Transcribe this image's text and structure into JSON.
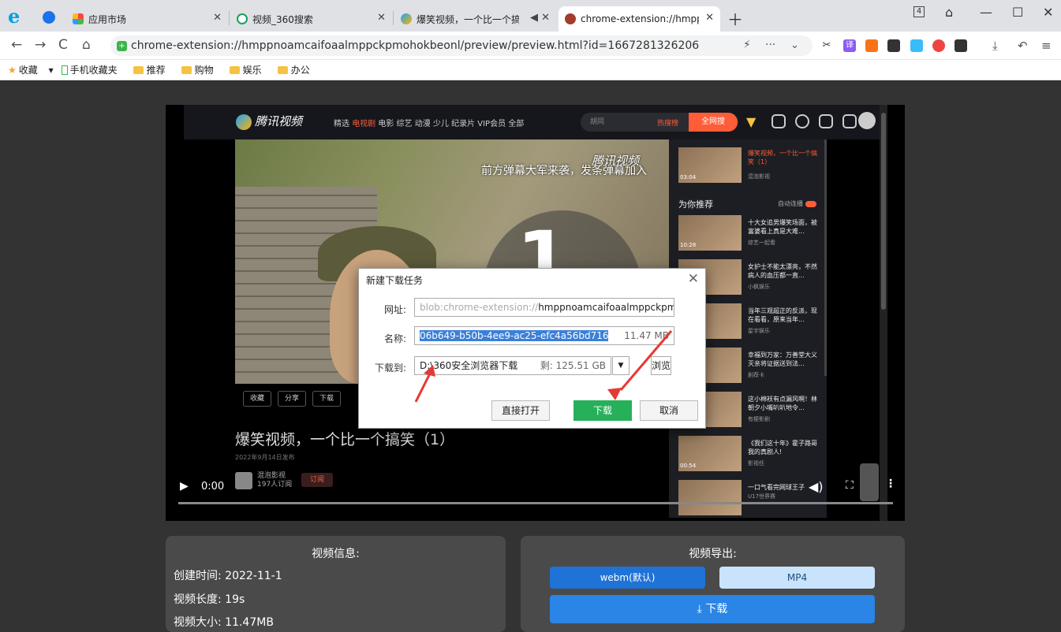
{
  "browser": {
    "tabs": [
      {
        "label": "应用市场"
      },
      {
        "label": "视频_360搜索"
      },
      {
        "label": "爆笑视频，一个比一个搞笑"
      },
      {
        "label": "chrome-extension://hmppnc"
      }
    ],
    "address": "chrome-extension://hmppnoamcaifoaalmppckpmohokbeonl/preview/preview.html?id=1667281326206",
    "bookmarks": [
      "收藏",
      "手机收藏夹",
      "推荐",
      "购物",
      "娱乐",
      "办公"
    ]
  },
  "video": {
    "site_name": "腾讯视频",
    "nav": "精选 电视剧 电影 综艺 动漫 少儿 纪录片 VIP会员 全部",
    "nav_active": "电视剧",
    "search_placeholder": "胡同",
    "hot_label": "热搜榜",
    "search_btn": "全网搜",
    "danmu": "前方弹幕大军来袭，发条弹幕加入",
    "watermark": "腾讯视频",
    "overlay_number": "1",
    "actions": [
      "收藏",
      "分享",
      "下载"
    ],
    "title": "爆笑视频，一个比一个搞笑（1）",
    "date": "2022年9月14日发布",
    "channel": "混泡影视",
    "subscribers": "197人订阅",
    "subscribe_label": "订阅",
    "time": "0:00",
    "recommend_label": "为你推荐",
    "autoplay_label": "自动连播",
    "side_items": [
      {
        "title": "爆笑视频，一个比一个搞笑（1）",
        "channel": "混泡影视",
        "duration": "03:04"
      },
      {
        "title": "十大女追男爆笑场面，被富婆看上真是大难...",
        "channel": "综艺一起看",
        "duration": "10:28"
      },
      {
        "title": "女护士不能太漂亮，不然病人的血压都一直...",
        "channel": "小枫娱乐",
        "duration": ""
      },
      {
        "title": "当年三观超正的反派，现在看看，原来当年...",
        "channel": "星宇娱乐",
        "duration": ""
      },
      {
        "title": "幸福到万家：万善堂大义灭亲将证据送到法...",
        "channel": "剧荐卡",
        "duration": ""
      },
      {
        "title": "这小棉袄有点漏风啊！林朝夕小嘴叭叭地令...",
        "channel": "有梗影剧",
        "duration": ""
      },
      {
        "title": "《我们这十年》霍子路哥我的真剧人!",
        "channel": "影视任",
        "duration": "00:54"
      },
      {
        "title": "一口气看完网球王子",
        "channel": "U17世界赛",
        "duration": ""
      }
    ]
  },
  "dialog": {
    "title": "新建下载任务",
    "url_label": "网址:",
    "url_prefix": "blob:chrome-extension://",
    "url_value": "hmppnoamcaifoaalmppckpmoho",
    "name_label": "名称:",
    "name_value": "06b649-b50b-4ee9-ac25-efc4a56bd716",
    "name_size": "11.47 MB",
    "path_label": "下载到:",
    "path_value": "D:\\360安全浏览器下载",
    "free_space": "剩: 125.51 GB",
    "browse_label": "浏览",
    "open_label": "直接打开",
    "download_label": "下载",
    "cancel_label": "取消"
  },
  "info": {
    "title": "视频信息:",
    "created": "创建时间: 2022-11-1",
    "length": "视频长度: 19s",
    "size": "视频大小: 11.47MB"
  },
  "export": {
    "title": "视频导出:",
    "webm_label": "webm(默认)",
    "mp4_label": "MP4",
    "download_label": "下载"
  }
}
